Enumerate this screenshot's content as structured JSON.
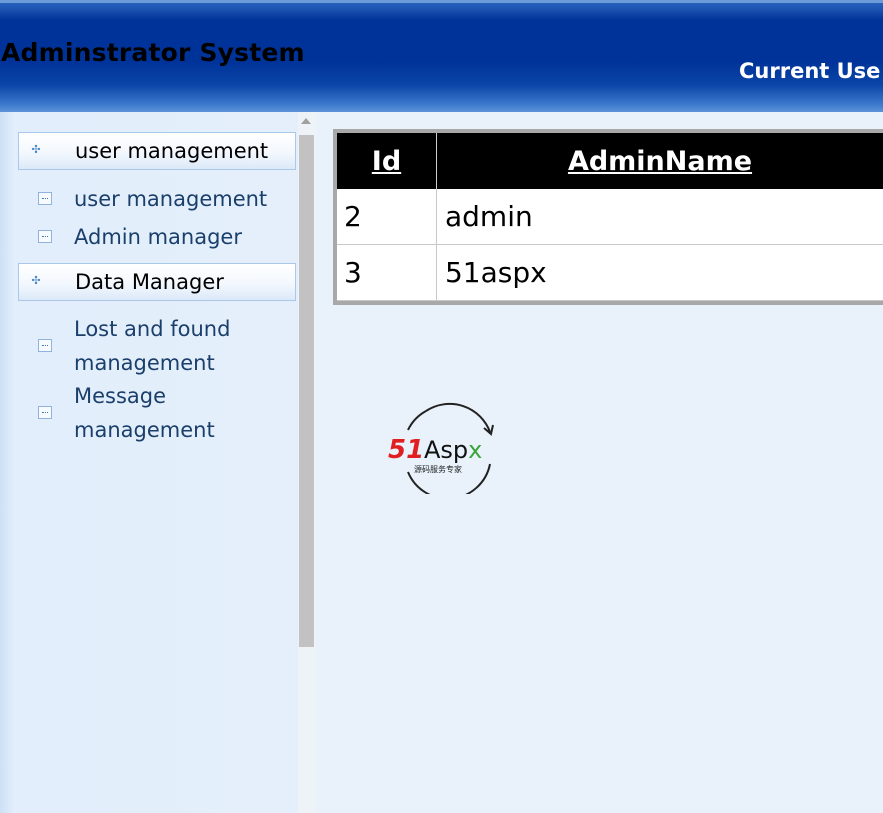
{
  "header": {
    "app_title": "Adminstrator System",
    "current_user_label": "Current Use"
  },
  "sidebar": {
    "groups": [
      {
        "label": "user management",
        "items": [
          {
            "label": "user management"
          },
          {
            "label": "Admin manager"
          }
        ]
      },
      {
        "label": "Data Manager",
        "items": [
          {
            "label": "Lost and found management"
          },
          {
            "label": "Message management"
          }
        ]
      }
    ]
  },
  "table": {
    "headers": [
      "Id",
      "AdminName"
    ],
    "rows": [
      [
        "2",
        "admin"
      ],
      [
        "3",
        "51aspx"
      ]
    ]
  },
  "logo": {
    "brand_number": "51",
    "brand_name": "Aspx",
    "tagline": "源码服务专家",
    "colors": {
      "number": "#e02020",
      "name": "#111111",
      "accent": "#3aa63a"
    }
  },
  "colors": {
    "header_bg": "#003399",
    "grid_header_bg": "#000000",
    "sidebar_bg": "#e2eefb",
    "content_bg": "#e9f2fb"
  },
  "icons": {
    "group": "plus-cross-icon",
    "item": "list-item-icon"
  }
}
